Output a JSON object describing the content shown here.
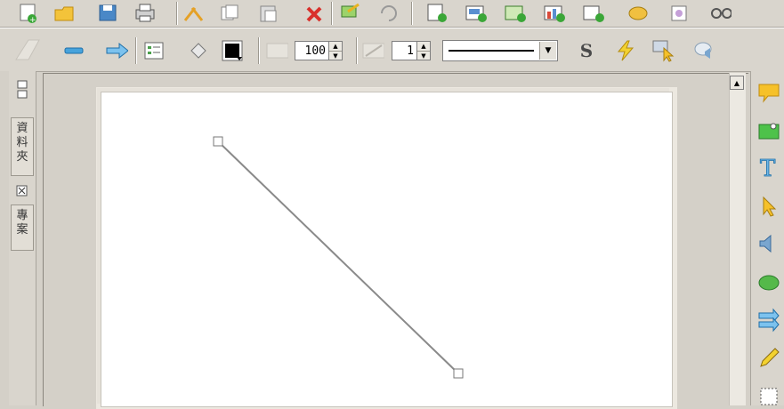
{
  "toolbar_top": {
    "icons": [
      "new-page-icon",
      "open-folder-icon",
      "save-icon",
      "print-icon",
      "cut-icon",
      "copy-icon",
      "paste-icon",
      "delete-icon",
      "insert-image-icon",
      "undo-icon",
      "insert-page-icon",
      "insert-slide-icon",
      "insert-picture-icon",
      "insert-chart-icon",
      "insert-object-icon",
      "link-icon",
      "media-icon",
      "glasses-icon"
    ]
  },
  "toolbar_format": {
    "opacity_value": "100",
    "line_width_value": "1",
    "shadow_label": "S",
    "fill_color": "#000000"
  },
  "left_panel": {
    "tabs": [
      {
        "label": "資\n料\n夾",
        "icon": "folder-toggle-icon"
      },
      {
        "label": "專\n案",
        "icon": "close-box-icon"
      }
    ]
  },
  "right_tools": [
    "callout-icon",
    "note-icon",
    "text-tool-icon",
    "select-arrow-icon",
    "speaker-icon",
    "shape-icon",
    "flow-arrow-icon",
    "pencil-icon",
    "marquee-icon"
  ]
}
